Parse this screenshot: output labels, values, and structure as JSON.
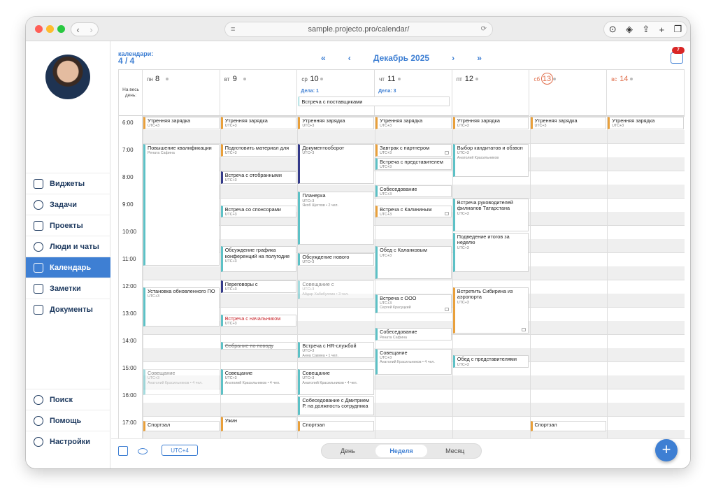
{
  "browser": {
    "url": "sample.projecto.pro/calendar/"
  },
  "sidebar": {
    "items": [
      {
        "label": "Виджеты",
        "icon": "widgets-icon",
        "active": false
      },
      {
        "label": "Задачи",
        "icon": "tasks-icon",
        "active": false
      },
      {
        "label": "Проекты",
        "icon": "projects-icon",
        "active": false
      },
      {
        "label": "Люди и чаты",
        "icon": "people-icon",
        "active": false
      },
      {
        "label": "Календарь",
        "icon": "calendar-icon",
        "active": true
      },
      {
        "label": "Заметки",
        "icon": "notes-icon",
        "active": false
      },
      {
        "label": "Документы",
        "icon": "documents-icon",
        "active": false
      }
    ],
    "bottom_items": [
      {
        "label": "Поиск",
        "icon": "search-icon"
      },
      {
        "label": "Помощь",
        "icon": "help-icon"
      },
      {
        "label": "Настройки",
        "icon": "settings-icon"
      }
    ]
  },
  "header": {
    "calendars_label": "календари:",
    "calendars_count": "4 / 4",
    "month": "Декабрь 2025",
    "notifications": "7"
  },
  "allday_label": "На весь день:",
  "days": [
    {
      "name": "пн",
      "num": "8",
      "count": "",
      "weekend": false
    },
    {
      "name": "вт",
      "num": "9",
      "count": "",
      "weekend": false
    },
    {
      "name": "ср",
      "num": "10",
      "count": "Дела: 1",
      "weekend": false
    },
    {
      "name": "чт",
      "num": "11",
      "count": "Дела: 3",
      "weekend": false
    },
    {
      "name": "пт",
      "num": "12",
      "count": "",
      "weekend": false
    },
    {
      "name": "сб",
      "num": "13",
      "count": "",
      "weekend": true,
      "today": true
    },
    {
      "name": "вс",
      "num": "14",
      "count": "",
      "weekend": true
    }
  ],
  "allday_events": [
    {
      "day": 2,
      "span": 2,
      "title": "Встреча с поставщиками"
    }
  ],
  "hours": [
    "6:00",
    "7:00",
    "8:00",
    "9:00",
    "10:00",
    "11:00",
    "12:00",
    "13:00",
    "14:00",
    "15:00",
    "16:00",
    "17:00"
  ],
  "grid_start_hour": 6,
  "events": [
    {
      "day": 0,
      "start": 6.0,
      "end": 6.5,
      "title": "Утренняя зарядка",
      "sub": "UTC+3",
      "people": "",
      "kind": "o"
    },
    {
      "day": 1,
      "start": 6.0,
      "end": 6.5,
      "title": "Утренняя зарядка",
      "sub": "UTC+3",
      "people": "",
      "kind": "o"
    },
    {
      "day": 2,
      "start": 6.0,
      "end": 6.5,
      "title": "Утренняя зарядка",
      "sub": "UTC+3",
      "people": "",
      "kind": "o"
    },
    {
      "day": 3,
      "start": 6.0,
      "end": 6.5,
      "title": "Утренняя зарядка",
      "sub": "UTC+3",
      "people": "",
      "kind": "o"
    },
    {
      "day": 4,
      "start": 6.0,
      "end": 6.5,
      "title": "Утренняя зарядка",
      "sub": "UTC+3",
      "people": "",
      "kind": "o"
    },
    {
      "day": 5,
      "start": 6.0,
      "end": 6.5,
      "title": "Утренняя зарядка",
      "sub": "UTC+3",
      "people": "",
      "kind": "o"
    },
    {
      "day": 6,
      "start": 6.0,
      "end": 6.5,
      "title": "Утренняя зарядка",
      "sub": "UTC+3",
      "people": "",
      "kind": "o"
    },
    {
      "day": 0,
      "start": 7.0,
      "end": 11.5,
      "title": "Повышение квалификации",
      "sub": "",
      "people": "Рената Сафина",
      "kind": "t"
    },
    {
      "day": 0,
      "start": 12.25,
      "end": 13.75,
      "title": "Установка обновленного ПО",
      "sub": "UTC+3",
      "people": "",
      "kind": "t"
    },
    {
      "day": 0,
      "start": 15.25,
      "end": 16.25,
      "title": "Совещание",
      "sub": "UTC+3",
      "people": "Анатолий Красильников • 4 чел.",
      "kind": "g"
    },
    {
      "day": 0,
      "start": 17.15,
      "end": 17.6,
      "title": "Спортзал",
      "sub": "",
      "people": "",
      "kind": "o"
    },
    {
      "day": 1,
      "start": 7.0,
      "end": 7.5,
      "title": "Подготовить материал для",
      "sub": "UTC+3",
      "people": "",
      "kind": "o"
    },
    {
      "day": 1,
      "start": 8.0,
      "end": 8.5,
      "title": "Встреча с отобранными",
      "sub": "UTC+3",
      "people": "",
      "kind": "d"
    },
    {
      "day": 1,
      "start": 9.25,
      "end": 9.75,
      "title": "Встреча со спонсорами",
      "sub": "UTC+3",
      "people": "",
      "kind": "t"
    },
    {
      "day": 1,
      "start": 10.75,
      "end": 11.75,
      "title": "Обсуждение графика конференций на полугодие",
      "sub": "UTC+3",
      "people": "",
      "kind": "t"
    },
    {
      "day": 1,
      "start": 12.0,
      "end": 12.5,
      "title": "Переговоры с",
      "sub": "UTC+3",
      "people": "",
      "kind": "d"
    },
    {
      "day": 1,
      "start": 13.25,
      "end": 13.75,
      "title": "Встреча с начальником",
      "sub": "UTC+3",
      "people": "",
      "kind": "red"
    },
    {
      "day": 1,
      "start": 14.25,
      "end": 14.6,
      "title": "Собрание по поводу",
      "sub": "",
      "people": "",
      "kind": "st"
    },
    {
      "day": 1,
      "start": 15.25,
      "end": 16.25,
      "title": "Совещание",
      "sub": "UTC+3",
      "people": "Анатолий Красильников • 4 чел.",
      "kind": "t"
    },
    {
      "day": 1,
      "start": 17.0,
      "end": 17.6,
      "title": "Ужин",
      "sub": "",
      "people": "",
      "kind": "o"
    },
    {
      "day": 2,
      "start": 7.0,
      "end": 8.5,
      "title": "Документооборот",
      "sub": "UTC+3",
      "people": "",
      "kind": "d"
    },
    {
      "day": 2,
      "start": 8.75,
      "end": 10.75,
      "title": "Планерка",
      "sub": "UTC+3",
      "people": "Якоб Щеглов • 2 чел.",
      "kind": "t"
    },
    {
      "day": 2,
      "start": 11.0,
      "end": 11.5,
      "title": "Обсуждение нового",
      "sub": "UTC+3",
      "people": "",
      "kind": "t"
    },
    {
      "day": 2,
      "start": 12.0,
      "end": 12.75,
      "title": "Совещание с",
      "sub": "UTC+3",
      "people": "Айдар Хабибуллин • 3 чел.",
      "kind": "g"
    },
    {
      "day": 2,
      "start": 14.25,
      "end": 14.9,
      "title": "Встреча с HR-службой",
      "sub": "UTC+3",
      "people": "Анна Савина • 1 чел.",
      "kind": "t"
    },
    {
      "day": 2,
      "start": 15.25,
      "end": 16.25,
      "title": "Совещание",
      "sub": "UTC+3",
      "people": "Анатолий Красильников • 4 чел.",
      "kind": "t"
    },
    {
      "day": 2,
      "start": 16.25,
      "end": 17.0,
      "title": "Собеседование с Дмитрием Р. на должность сотрудника",
      "sub": "",
      "people": "",
      "kind": "t"
    },
    {
      "day": 2,
      "start": 17.15,
      "end": 17.6,
      "title": "Спортзал",
      "sub": "",
      "people": "",
      "kind": "o"
    },
    {
      "day": 3,
      "start": 7.0,
      "end": 7.5,
      "title": "Завтрак с партнером",
      "sub": "UTC+3",
      "people": "",
      "kind": "o",
      "lock": true
    },
    {
      "day": 3,
      "start": 7.5,
      "end": 8.0,
      "title": "Встреча с представителем",
      "sub": "UTC+3",
      "people": "",
      "kind": "t"
    },
    {
      "day": 3,
      "start": 8.5,
      "end": 9.0,
      "title": "Собеседование",
      "sub": "UTC+3",
      "people": "",
      "kind": "t"
    },
    {
      "day": 3,
      "start": 9.25,
      "end": 9.75,
      "title": "Встреча с Калининым",
      "sub": "UTC+3",
      "people": "",
      "kind": "o",
      "lock": true
    },
    {
      "day": 3,
      "start": 10.75,
      "end": 12.0,
      "title": "Обед с Каланковым",
      "sub": "UTC+3",
      "people": "",
      "kind": "t"
    },
    {
      "day": 3,
      "start": 12.5,
      "end": 13.25,
      "title": "Встреча с ООО",
      "sub": "UTC+3",
      "people": "Сергей Красуцкий",
      "kind": "t",
      "lock": true
    },
    {
      "day": 3,
      "start": 13.75,
      "end": 14.25,
      "title": "Собеседование",
      "sub": "",
      "people": "Рената Сафина",
      "kind": "t"
    },
    {
      "day": 3,
      "start": 14.5,
      "end": 15.5,
      "title": "Совещание",
      "sub": "UTC+3",
      "people": "Анатолий Красильников • 4 чел.",
      "kind": "t"
    },
    {
      "day": 4,
      "start": 7.0,
      "end": 8.25,
      "title": "Выбор кандитатов и обзвон",
      "sub": "UTC+3",
      "people": "Анатолий Красильников",
      "kind": "t"
    },
    {
      "day": 4,
      "start": 9.0,
      "end": 10.25,
      "title": "Встреча руководителей филиалов Татарстана",
      "sub": "UTC+3",
      "people": "",
      "kind": "t"
    },
    {
      "day": 4,
      "start": 10.25,
      "end": 11.75,
      "title": "Подведение итогов за неделю",
      "sub": "UTC+3",
      "people": "",
      "kind": "t"
    },
    {
      "day": 4,
      "start": 12.25,
      "end": 14.0,
      "title": "Встретить Сибирина из аэропорта",
      "sub": "UTC+3",
      "people": "",
      "kind": "o",
      "lock": true
    },
    {
      "day": 4,
      "start": 14.75,
      "end": 15.25,
      "title": "Обед с представителями",
      "sub": "UTC+3",
      "people": "",
      "kind": "t"
    },
    {
      "day": 5,
      "start": 17.15,
      "end": 17.6,
      "title": "Спортзал",
      "sub": "",
      "people": "",
      "kind": "o"
    }
  ],
  "bottom": {
    "utc": "UTC+4",
    "views": [
      "День",
      "Неделя",
      "Месяц"
    ],
    "active_view": 1,
    "fab": "+"
  }
}
